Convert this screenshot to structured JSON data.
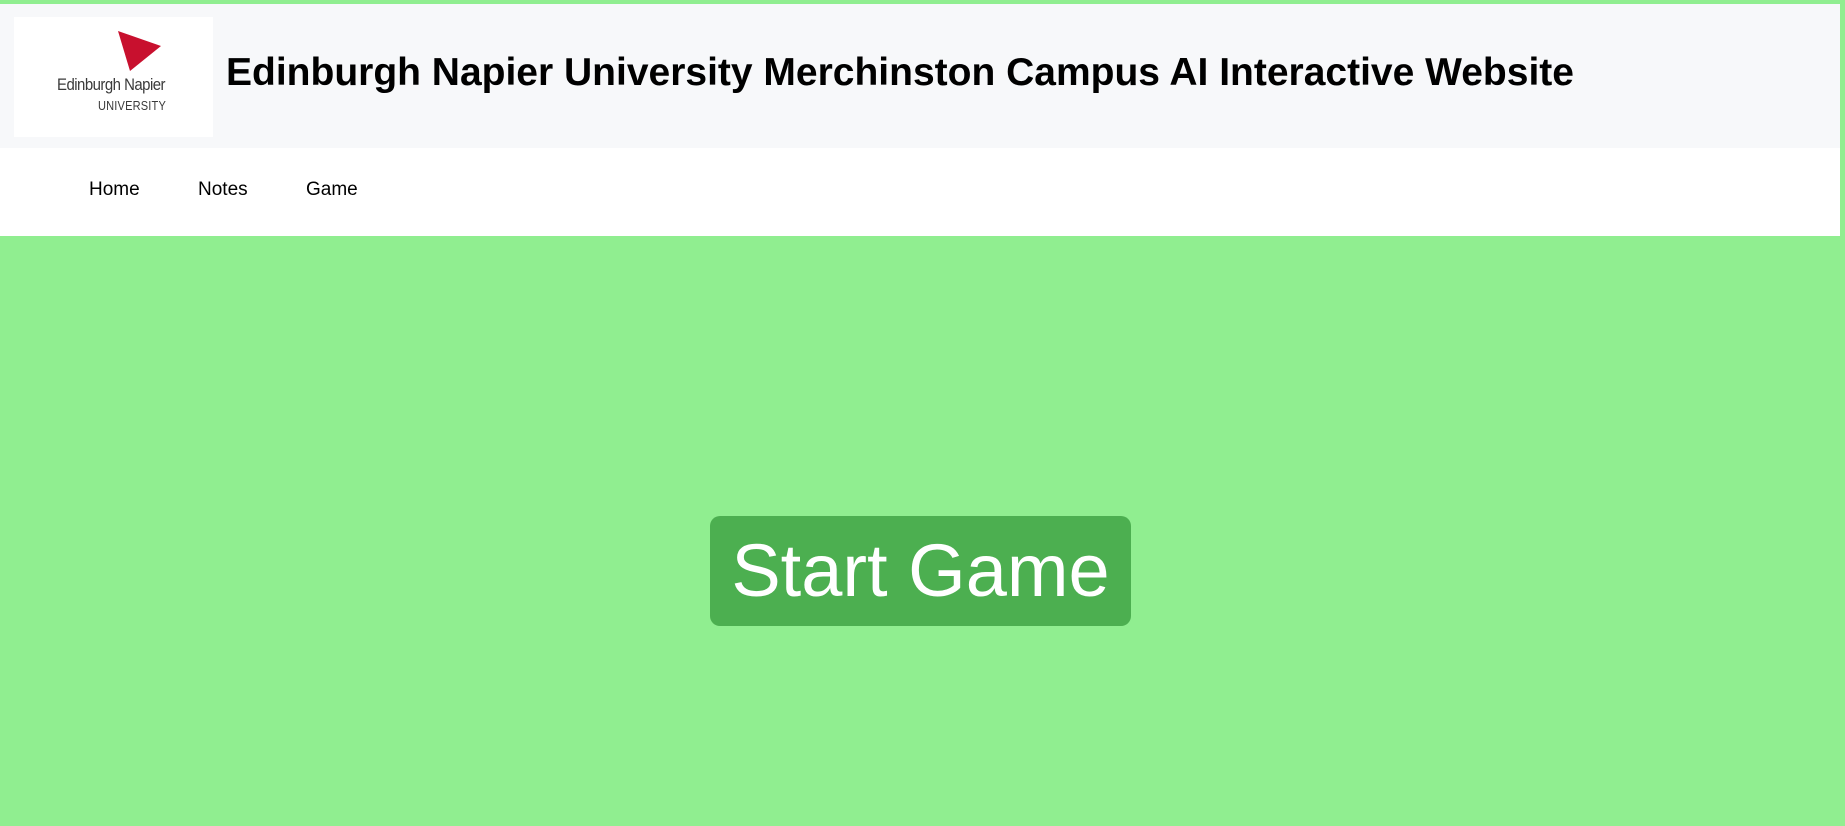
{
  "header": {
    "logo": {
      "icon": "red-triangle-logo-icon",
      "line1": "Edinburgh Napier",
      "line2": "UNIVERSITY",
      "accent_color": "#c8102e"
    },
    "title": "Edinburgh Napier University Merchinston Campus AI Interactive Website"
  },
  "nav": {
    "items": [
      {
        "label": "Home"
      },
      {
        "label": "Notes"
      },
      {
        "label": "Game"
      }
    ]
  },
  "main": {
    "start_button_label": "Start Game",
    "background_color": "#90ee90",
    "button_color": "#4caf50"
  }
}
